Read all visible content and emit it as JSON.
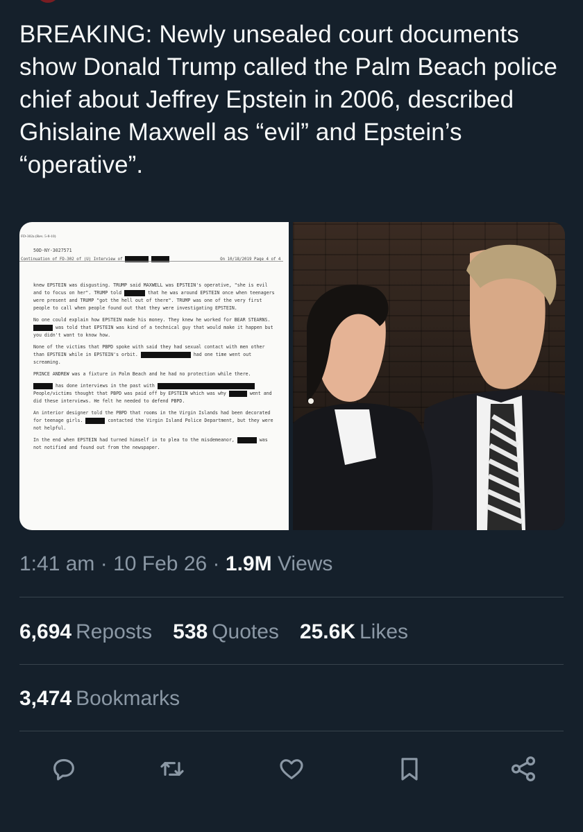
{
  "tweet": {
    "text": "BREAKING: Newly unsealed court documents show Donald Trump called the Palm Beach police chief about Jeffrey Epstein in 2006, described Ghislaine Maxwell as “evil” and Epstein’s “operative”."
  },
  "document": {
    "form_id": "FD-302a (Rev. 5-8-10)",
    "file_number": "50D-NY-3027571",
    "continuation": "Continuation of FD-302 of",
    "interview_of": "(U) Interview of",
    "on_label": "On",
    "date": "10/18/2019",
    "page_label": "Page",
    "page_of": "4 of 4",
    "p1": "knew EPSTEIN was disgusting. TRUMP said MAXWELL was EPSTEIN's operative, \"she is evil and to focus on her\". TRUMP told",
    "p1b": "that he was around EPSTEIN once when teenagers were present and TRUMP \"got the hell out of there\". TRUMP was one of the very first people to call when people found out that they were investigating EPSTEIN.",
    "p2": "No one could explain how EPSTEIN made his money. They knew he worked for BEAR STEARNS.",
    "p2b": "was told that EPSTEIN was kind of a technical guy that would make it happen but you didn't want to know how.",
    "p3": "None of the victims that PBPD spoke with said they had sexual contact with men other than EPSTEIN while in EPSTEIN's orbit.",
    "p3b": "had one time went out screaming.",
    "p4": "PRINCE ANDREW was a fixture in Palm Beach and he had no protection while there.",
    "p5": "has done interviews in the past with",
    "p5b": "People/victims thought that PBPD was paid off by EPSTEIN which was why",
    "p5c": "went and did these interviews. He felt he needed to defend PBPD.",
    "p6": "An interior designer told the PBPD that rooms in the Virgin Islands had been decorated for teenage girls.",
    "p6b": "contacted the Virgin Island Police Department, but they were not helpful.",
    "p7": "In the end when EPSTEIN had turned himself in to plea to the misdemeanor,",
    "p7b": "was not notified and found out from the newspaper."
  },
  "meta": {
    "time": "1:41 am",
    "sep1": "·",
    "date": "10 Feb 26",
    "sep2": "·",
    "views_count": "1.9M",
    "views_label": "Views"
  },
  "stats": {
    "reposts_count": "6,694",
    "reposts_label": "Reposts",
    "quotes_count": "538",
    "quotes_label": "Quotes",
    "likes_count": "25.6K",
    "likes_label": "Likes",
    "bookmarks_count": "3,474",
    "bookmarks_label": "Bookmarks"
  },
  "actions": [
    "reply-icon",
    "repost-icon",
    "like-icon",
    "bookmark-icon",
    "share-icon"
  ],
  "colors": {
    "background": "#15202b",
    "text": "#f7f9f9",
    "muted": "#8b98a5",
    "accent": "#1d9bf0",
    "divider": "#38444d"
  }
}
